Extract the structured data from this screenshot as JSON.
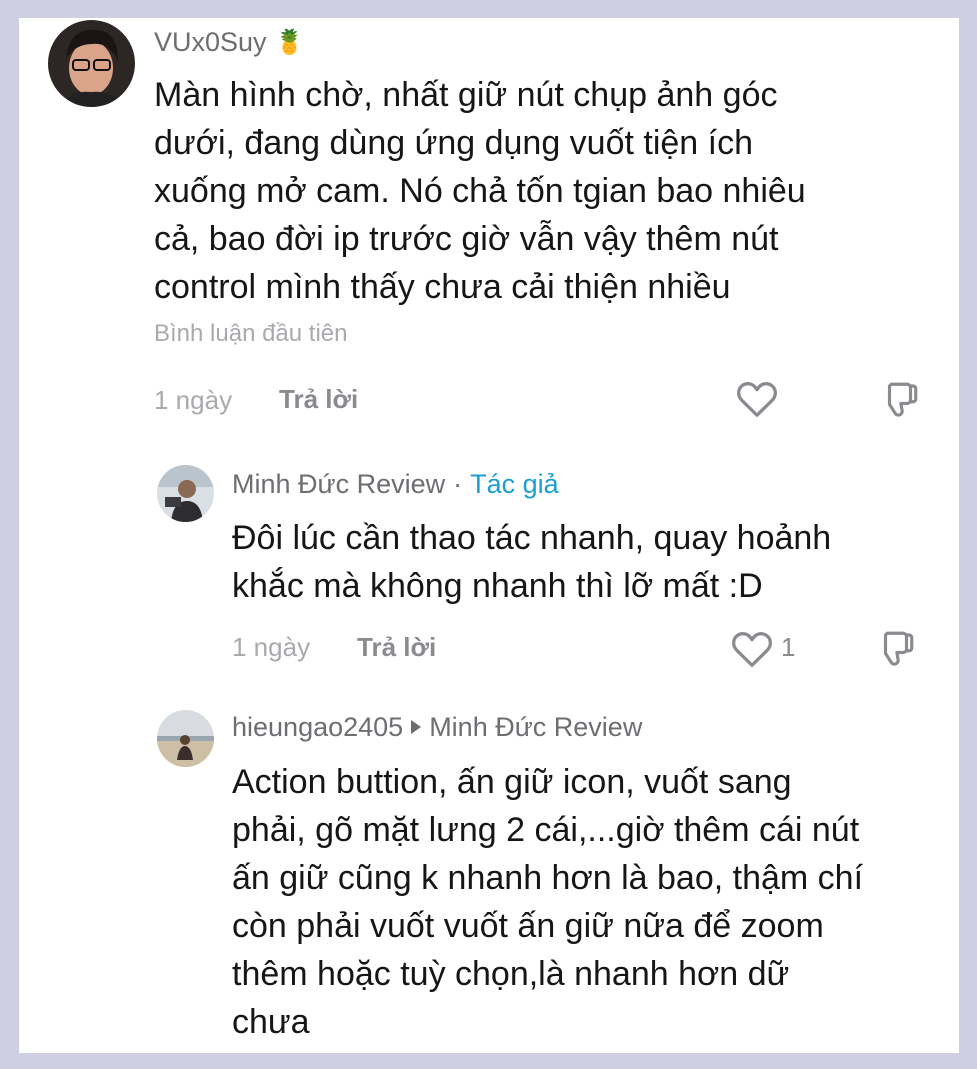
{
  "comments": [
    {
      "username": "VUx0Suy",
      "emoji": "🍍",
      "lines": [
        "Màn hình chờ, nhất giữ nút chụp ảnh góc",
        "dưới, đang dùng ứng dụng vuốt tiện ích",
        "xuống mở cam. Nó chả tốn tgian bao nhiêu",
        "cả, bao đời ip trước giờ vẫn vậy thêm nút",
        "control mình thấy chưa cải thiện nhiều"
      ],
      "label": "Bình luận đầu tiên",
      "time": "1 ngày",
      "reply_label": "Trả lời"
    },
    {
      "username": "Minh Đức Review",
      "separator": "·",
      "author_tag": "Tác giả",
      "lines": [
        "Đôi lúc cần thao tác nhanh, quay hoảnh",
        "khắc mà không nhanh thì lỡ mất :D"
      ],
      "time": "1 ngày",
      "reply_label": "Trả lời",
      "like_count": "1"
    },
    {
      "username": "hieungao2405",
      "reply_to": "Minh Đức Review",
      "lines": [
        "Action buttion, ấn giữ icon, vuốt sang",
        "phải, gõ mặt lưng 2 cái,...giờ thêm cái nút",
        "ấn giữ cũng k nhanh hơn là bao, thậm chí",
        "còn phải vuốt vuốt ấn giữ nữa để zoom",
        "thêm hoặc tuỳ chọn,là nhanh hơn dữ",
        "chưa"
      ]
    }
  ],
  "icons": {
    "like": "heart-outline-icon",
    "dislike": "thumbs-down-outline-icon",
    "reply_arrow": "play-arrow-icon"
  }
}
